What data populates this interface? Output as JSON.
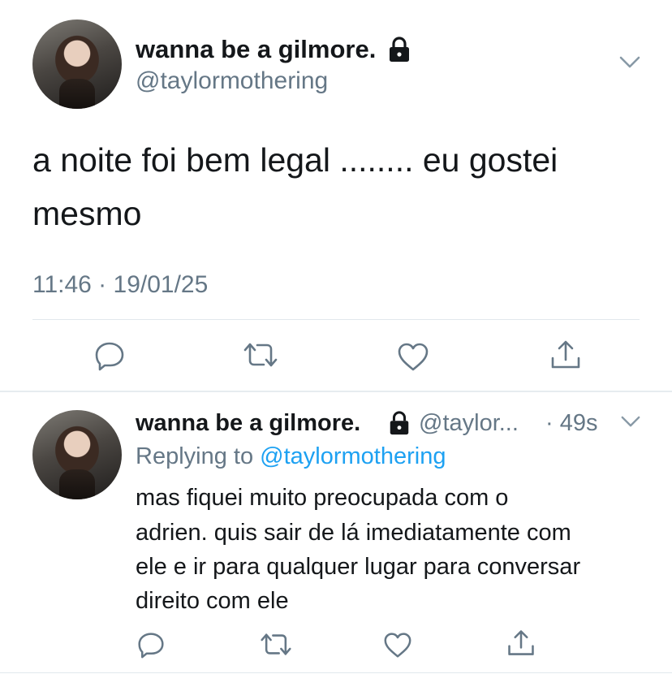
{
  "main_tweet": {
    "display_name": "wanna be a gilmore.",
    "handle": "@taylormothering",
    "text_line1": "a noite foi bem legal ........ eu gostei",
    "text_line2": "mesmo",
    "timestamp": "11:46 · 19/01/25"
  },
  "reply_tweet": {
    "display_name": "wanna be a gilmore.",
    "handle_truncated": "@taylor...",
    "age": "· 49s",
    "replying_prefix": "Replying to",
    "replying_to": "@taylormothering",
    "text_lines": [
      "mas fiquei muito preocupada com o",
      "adrien. quis sair de lá imediatamente com",
      "ele e ir para qualquer lugar para conversar",
      "direito com ele"
    ]
  },
  "icons": {
    "lock": "lock-icon",
    "chevron": "chevron-down-icon",
    "reply": "reply-icon",
    "retweet": "retweet-icon",
    "like": "heart-icon",
    "share": "share-icon"
  },
  "colors": {
    "text": "#14171a",
    "secondary": "#657786",
    "link": "#1da1f2",
    "divider": "#e1e8ed"
  }
}
